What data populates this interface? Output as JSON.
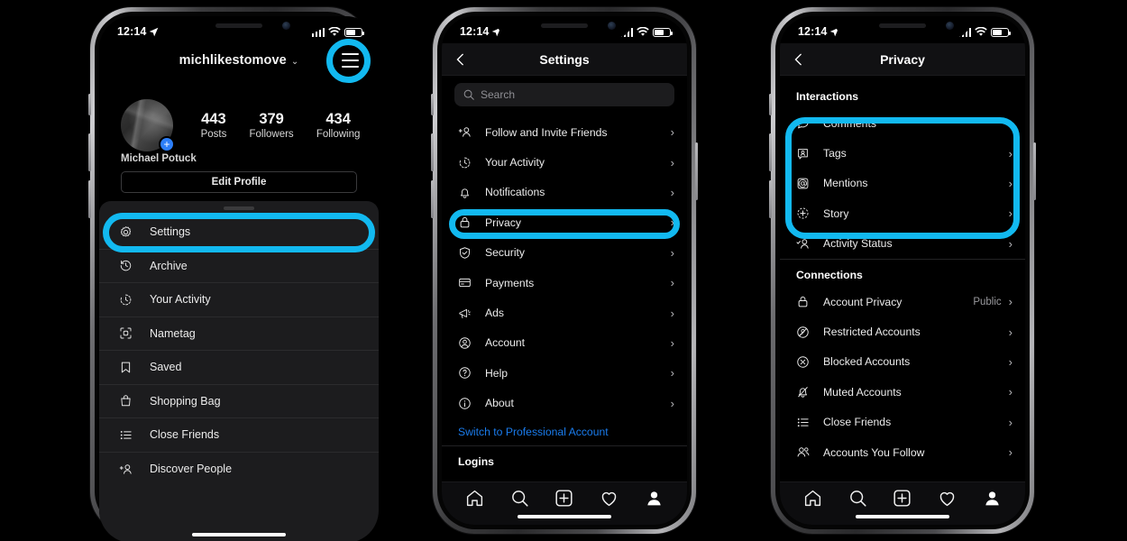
{
  "status_bar": {
    "time": "12:14",
    "location_icon": "location-arrow-icon",
    "signal_icon": "cellular-signal-icon",
    "wifi_icon": "wifi-icon",
    "battery_icon": "battery-icon"
  },
  "highlight_color": "#12b9f0",
  "phone1": {
    "username": "michlikestomove",
    "username_chevron": "⌄",
    "menu_icon": "hamburger-menu-icon",
    "stats": [
      {
        "number": "443",
        "label": "Posts"
      },
      {
        "number": "379",
        "label": "Followers"
      },
      {
        "number": "434",
        "label": "Following"
      }
    ],
    "display_name": "Michael Potuck",
    "edit_profile_label": "Edit Profile",
    "avatar_badge": "+",
    "menu_items": [
      {
        "label": "Settings",
        "icon": "gear-icon",
        "highlighted": true
      },
      {
        "label": "Archive",
        "icon": "archive-clock-icon",
        "highlighted": false
      },
      {
        "label": "Your Activity",
        "icon": "activity-clock-icon",
        "highlighted": false
      },
      {
        "label": "Nametag",
        "icon": "nametag-icon",
        "highlighted": false
      },
      {
        "label": "Saved",
        "icon": "bookmark-icon",
        "highlighted": false
      },
      {
        "label": "Shopping Bag",
        "icon": "shopping-bag-icon",
        "highlighted": false
      },
      {
        "label": "Close Friends",
        "icon": "close-friends-list-icon",
        "highlighted": false
      },
      {
        "label": "Discover People",
        "icon": "discover-people-icon",
        "highlighted": false
      }
    ]
  },
  "phone2": {
    "nav_title": "Settings",
    "back_icon": "chevron-left-icon",
    "search_placeholder": "Search",
    "search_icon": "search-icon",
    "items": [
      {
        "label": "Follow and Invite Friends",
        "icon": "add-person-icon",
        "highlighted": false
      },
      {
        "label": "Your Activity",
        "icon": "activity-clock-icon",
        "highlighted": false
      },
      {
        "label": "Notifications",
        "icon": "bell-icon",
        "highlighted": false
      },
      {
        "label": "Privacy",
        "icon": "lock-icon",
        "highlighted": true
      },
      {
        "label": "Security",
        "icon": "shield-check-icon",
        "highlighted": false
      },
      {
        "label": "Payments",
        "icon": "credit-card-icon",
        "highlighted": false
      },
      {
        "label": "Ads",
        "icon": "megaphone-icon",
        "highlighted": false
      },
      {
        "label": "Account",
        "icon": "account-circle-icon",
        "highlighted": false
      },
      {
        "label": "Help",
        "icon": "question-circle-icon",
        "highlighted": false
      },
      {
        "label": "About",
        "icon": "info-circle-icon",
        "highlighted": false
      }
    ],
    "switch_professional_label": "Switch to Professional Account",
    "logins_header": "Logins",
    "tabbar": [
      "home-icon",
      "search-icon",
      "new-post-icon",
      "heart-icon",
      "profile-icon"
    ]
  },
  "phone3": {
    "nav_title": "Privacy",
    "back_icon": "chevron-left-icon",
    "section_interactions": "Interactions",
    "interactions": [
      {
        "label": "Comments",
        "icon": "comment-bubble-icon"
      },
      {
        "label": "Tags",
        "icon": "tag-person-icon"
      },
      {
        "label": "Mentions",
        "icon": "at-mention-icon"
      },
      {
        "label": "Story",
        "icon": "story-plus-icon"
      },
      {
        "label": "Activity Status",
        "icon": "activity-status-icon"
      }
    ],
    "section_connections": "Connections",
    "connections": [
      {
        "label": "Account Privacy",
        "icon": "lock-icon",
        "value": "Public"
      },
      {
        "label": "Restricted Accounts",
        "icon": "restricted-icon",
        "value": ""
      },
      {
        "label": "Blocked Accounts",
        "icon": "blocked-x-icon",
        "value": ""
      },
      {
        "label": "Muted Accounts",
        "icon": "muted-bell-icon",
        "value": ""
      },
      {
        "label": "Close Friends",
        "icon": "close-friends-list-icon",
        "value": ""
      },
      {
        "label": "Accounts You Follow",
        "icon": "people-group-icon",
        "value": ""
      }
    ],
    "chevron": "›",
    "tabbar": [
      "home-icon",
      "search-icon",
      "new-post-icon",
      "heart-icon",
      "profile-icon"
    ]
  }
}
